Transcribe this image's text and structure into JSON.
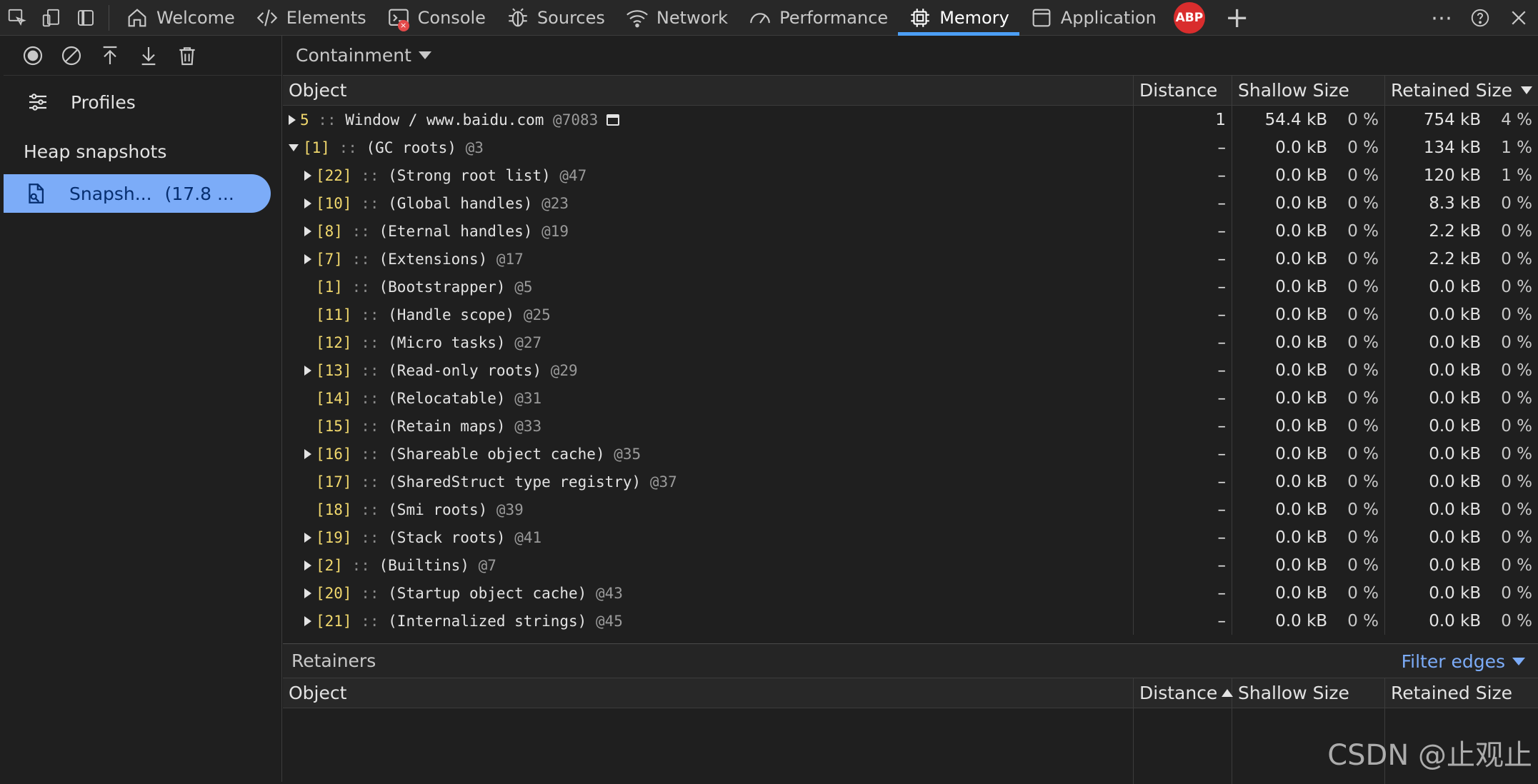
{
  "tabs": [
    {
      "label": "Welcome",
      "icon": "home-icon"
    },
    {
      "label": "Elements",
      "icon": "code-icon"
    },
    {
      "label": "Console",
      "icon": "console-icon"
    },
    {
      "label": "Sources",
      "icon": "bug-icon"
    },
    {
      "label": "Network",
      "icon": "wifi-icon"
    },
    {
      "label": "Performance",
      "icon": "gauge-icon"
    },
    {
      "label": "Memory",
      "icon": "chip-icon",
      "active": true
    },
    {
      "label": "Application",
      "icon": "square-icon"
    }
  ],
  "adblock_label": "ABP",
  "left_panel": {
    "profiles_label": "Profiles",
    "section_title": "Heap snapshots",
    "snapshot_name": "Snapsh...",
    "snapshot_size": "(17.8 ..."
  },
  "main": {
    "view_mode": "Containment",
    "columns": {
      "object": "Object",
      "distance": "Distance",
      "shallow": "Shallow Size",
      "retained": "Retained Size"
    },
    "rows": [
      {
        "expand": "right",
        "count": "5",
        "name": "Window / www.baidu.com",
        "id": "@7083",
        "window_icon": true,
        "distance": "1",
        "shallow": "54.4 kB",
        "shallow_pct": "0 %",
        "retained": "754 kB",
        "retained_pct": "4 %",
        "indent": 0
      },
      {
        "expand": "down",
        "count": "[1]",
        "name": "(GC roots)",
        "id": "@3",
        "distance": "–",
        "shallow": "0.0 kB",
        "shallow_pct": "0 %",
        "retained": "134 kB",
        "retained_pct": "1 %",
        "indent": 0
      },
      {
        "expand": "right",
        "count": "[22]",
        "name": "(Strong root list)",
        "id": "@47",
        "distance": "–",
        "shallow": "0.0 kB",
        "shallow_pct": "0 %",
        "retained": "120 kB",
        "retained_pct": "1 %",
        "indent": 1
      },
      {
        "expand": "right",
        "count": "[10]",
        "name": "(Global handles)",
        "id": "@23",
        "distance": "–",
        "shallow": "0.0 kB",
        "shallow_pct": "0 %",
        "retained": "8.3 kB",
        "retained_pct": "0 %",
        "indent": 1
      },
      {
        "expand": "right",
        "count": "[8]",
        "name": "(Eternal handles)",
        "id": "@19",
        "distance": "–",
        "shallow": "0.0 kB",
        "shallow_pct": "0 %",
        "retained": "2.2 kB",
        "retained_pct": "0 %",
        "indent": 1
      },
      {
        "expand": "right",
        "count": "[7]",
        "name": "(Extensions)",
        "id": "@17",
        "distance": "–",
        "shallow": "0.0 kB",
        "shallow_pct": "0 %",
        "retained": "2.2 kB",
        "retained_pct": "0 %",
        "indent": 1
      },
      {
        "expand": "none",
        "count": "[1]",
        "name": "(Bootstrapper)",
        "id": "@5",
        "distance": "–",
        "shallow": "0.0 kB",
        "shallow_pct": "0 %",
        "retained": "0.0 kB",
        "retained_pct": "0 %",
        "indent": 1
      },
      {
        "expand": "none",
        "count": "[11]",
        "name": "(Handle scope)",
        "id": "@25",
        "distance": "–",
        "shallow": "0.0 kB",
        "shallow_pct": "0 %",
        "retained": "0.0 kB",
        "retained_pct": "0 %",
        "indent": 1
      },
      {
        "expand": "none",
        "count": "[12]",
        "name": "(Micro tasks)",
        "id": "@27",
        "distance": "–",
        "shallow": "0.0 kB",
        "shallow_pct": "0 %",
        "retained": "0.0 kB",
        "retained_pct": "0 %",
        "indent": 1
      },
      {
        "expand": "right",
        "count": "[13]",
        "name": "(Read-only roots)",
        "id": "@29",
        "distance": "–",
        "shallow": "0.0 kB",
        "shallow_pct": "0 %",
        "retained": "0.0 kB",
        "retained_pct": "0 %",
        "indent": 1
      },
      {
        "expand": "none",
        "count": "[14]",
        "name": "(Relocatable)",
        "id": "@31",
        "distance": "–",
        "shallow": "0.0 kB",
        "shallow_pct": "0 %",
        "retained": "0.0 kB",
        "retained_pct": "0 %",
        "indent": 1
      },
      {
        "expand": "none",
        "count": "[15]",
        "name": "(Retain maps)",
        "id": "@33",
        "distance": "–",
        "shallow": "0.0 kB",
        "shallow_pct": "0 %",
        "retained": "0.0 kB",
        "retained_pct": "0 %",
        "indent": 1
      },
      {
        "expand": "right",
        "count": "[16]",
        "name": "(Shareable object cache)",
        "id": "@35",
        "distance": "–",
        "shallow": "0.0 kB",
        "shallow_pct": "0 %",
        "retained": "0.0 kB",
        "retained_pct": "0 %",
        "indent": 1
      },
      {
        "expand": "none",
        "count": "[17]",
        "name": "(SharedStruct type registry)",
        "id": "@37",
        "distance": "–",
        "shallow": "0.0 kB",
        "shallow_pct": "0 %",
        "retained": "0.0 kB",
        "retained_pct": "0 %",
        "indent": 1
      },
      {
        "expand": "none",
        "count": "[18]",
        "name": "(Smi roots)",
        "id": "@39",
        "distance": "–",
        "shallow": "0.0 kB",
        "shallow_pct": "0 %",
        "retained": "0.0 kB",
        "retained_pct": "0 %",
        "indent": 1
      },
      {
        "expand": "right",
        "count": "[19]",
        "name": "(Stack roots)",
        "id": "@41",
        "distance": "–",
        "shallow": "0.0 kB",
        "shallow_pct": "0 %",
        "retained": "0.0 kB",
        "retained_pct": "0 %",
        "indent": 1
      },
      {
        "expand": "right",
        "count": "[2]",
        "name": "(Builtins)",
        "id": "@7",
        "distance": "–",
        "shallow": "0.0 kB",
        "shallow_pct": "0 %",
        "retained": "0.0 kB",
        "retained_pct": "0 %",
        "indent": 1
      },
      {
        "expand": "right",
        "count": "[20]",
        "name": "(Startup object cache)",
        "id": "@43",
        "distance": "–",
        "shallow": "0.0 kB",
        "shallow_pct": "0 %",
        "retained": "0.0 kB",
        "retained_pct": "0 %",
        "indent": 1
      },
      {
        "expand": "right",
        "count": "[21]",
        "name": "(Internalized strings)",
        "id": "@45",
        "distance": "–",
        "shallow": "0.0 kB",
        "shallow_pct": "0 %",
        "retained": "0.0 kB",
        "retained_pct": "0 %",
        "indent": 1
      }
    ]
  },
  "retainers": {
    "title": "Retainers",
    "filter_label": "Filter edges",
    "columns": {
      "object": "Object",
      "distance": "Distance",
      "shallow": "Shallow Size",
      "retained": "Retained Size"
    }
  },
  "watermark": "CSDN @止观止",
  "colors": {
    "accent": "#4c9ff5",
    "selection": "#7cacf8",
    "count": "#f1d86d",
    "abp": "#d92d2d"
  }
}
